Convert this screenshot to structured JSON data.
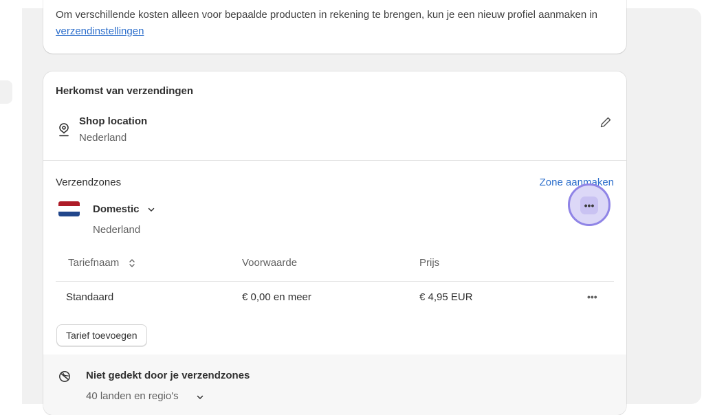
{
  "info": {
    "text": "Om verschillende kosten alleen voor bepaalde producten in rekening te brengen, kun je een nieuw profiel aanmaken in ",
    "link": "verzendinstellingen"
  },
  "origin": {
    "title": "Herkomst van verzendingen",
    "location_name": "Shop location",
    "location_country": "Nederland",
    "icons": {
      "location": "location-pin-icon",
      "edit": "pencil-icon"
    }
  },
  "zones": {
    "title": "Verzendzones",
    "create_label": "Zone aanmaken",
    "zone": {
      "name": "Domestic",
      "country": "Nederland",
      "flag_colors": [
        "#ae1c28",
        "#ffffff",
        "#21468b"
      ],
      "more_label": "•••"
    },
    "table": {
      "headers": [
        "Tariefnaam",
        "Voorwaarde",
        "Prijs"
      ],
      "rows": [
        {
          "name": "Standaard",
          "condition": "€ 0,00 en meer",
          "price": "€ 4,95 EUR",
          "more": "•••"
        }
      ]
    },
    "add_rate_label": "Tarief toevoegen"
  },
  "uncovered": {
    "title": "Niet gedekt door je verzendzones",
    "subtitle": "40 landen en regio's",
    "icon": "globe-off-icon"
  },
  "colors": {
    "accent": "#2c6ecb",
    "highlight_ring": "#8f84e6",
    "highlight_fill": "#dcd8f7"
  }
}
